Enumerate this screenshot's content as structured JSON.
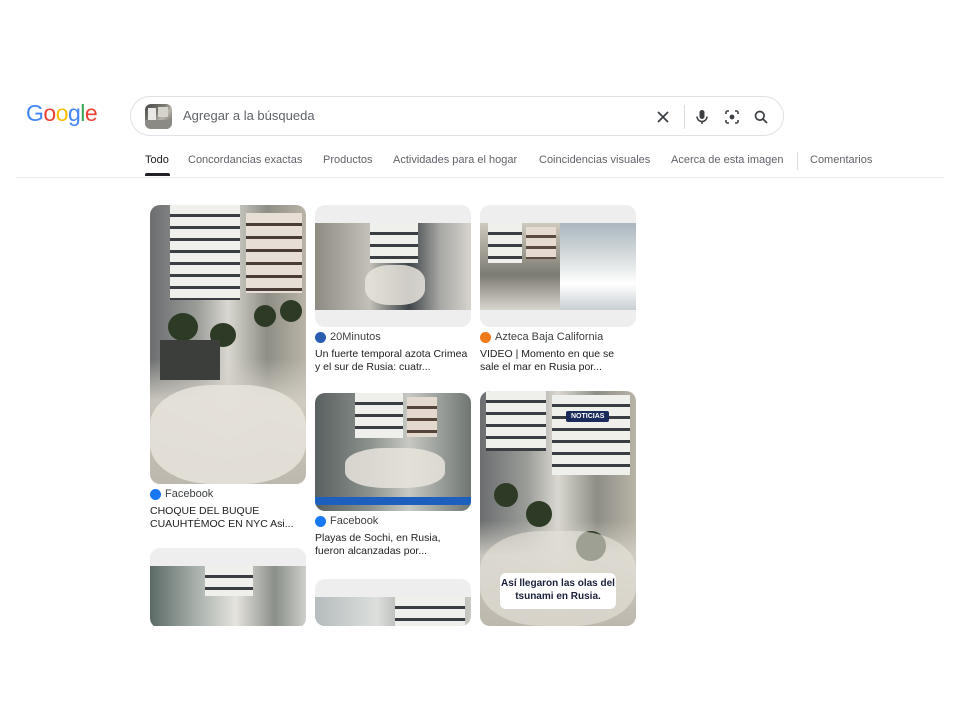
{
  "logo": {
    "letters": [
      "G",
      "o",
      "o",
      "g",
      "l",
      "e"
    ],
    "colors": [
      "#4285F4",
      "#EA4335",
      "#FBBC05",
      "#4285F4",
      "#34A853",
      "#EA4335"
    ]
  },
  "search": {
    "placeholder": "Agregar a la búsqueda",
    "icons": [
      "image-thumbnail",
      "close-icon",
      "mic-icon",
      "lens-icon",
      "search-icon"
    ]
  },
  "tabs": [
    {
      "label": "Todo",
      "active": true
    },
    {
      "label": "Concordancias exactas"
    },
    {
      "label": "Productos"
    },
    {
      "label": "Actividades para el hogar"
    },
    {
      "label": "Coincidencias visuales"
    },
    {
      "label": "Acerca de esta imagen"
    },
    {
      "label": "Comentarios"
    }
  ],
  "results": [
    {
      "source": "Facebook",
      "source_icon": "facebook-icon",
      "source_color": "#1877F2",
      "title": "CHOQUE DEL BUQUE CUAUHTÉMOC EN NYC Asi..."
    },
    {
      "source": "20Minutos",
      "source_icon": "20minutos-icon",
      "source_color": "#2a5db0",
      "title": "Un fuerte temporal azota Crimea y el sur de Rusia: cuatr..."
    },
    {
      "source": "Azteca Baja California",
      "source_icon": "azteca-icon",
      "source_color": "#f07a1a",
      "title": "VIDEO | Momento en que se sale el mar en Rusia por..."
    },
    {
      "source": "Facebook",
      "source_icon": "facebook-icon",
      "source_color": "#1877F2",
      "title": "Playas de Sochi, en Rusia, fueron alcanzadas por..."
    },
    {
      "source": "",
      "source_icon": "",
      "title": "",
      "overlay_caption": "Así llegaron las olas del tsunami en Rusia.",
      "overlay_badge": "NOTICIAS"
    },
    {
      "source": "",
      "title": ""
    },
    {
      "source": "",
      "title": ""
    }
  ]
}
